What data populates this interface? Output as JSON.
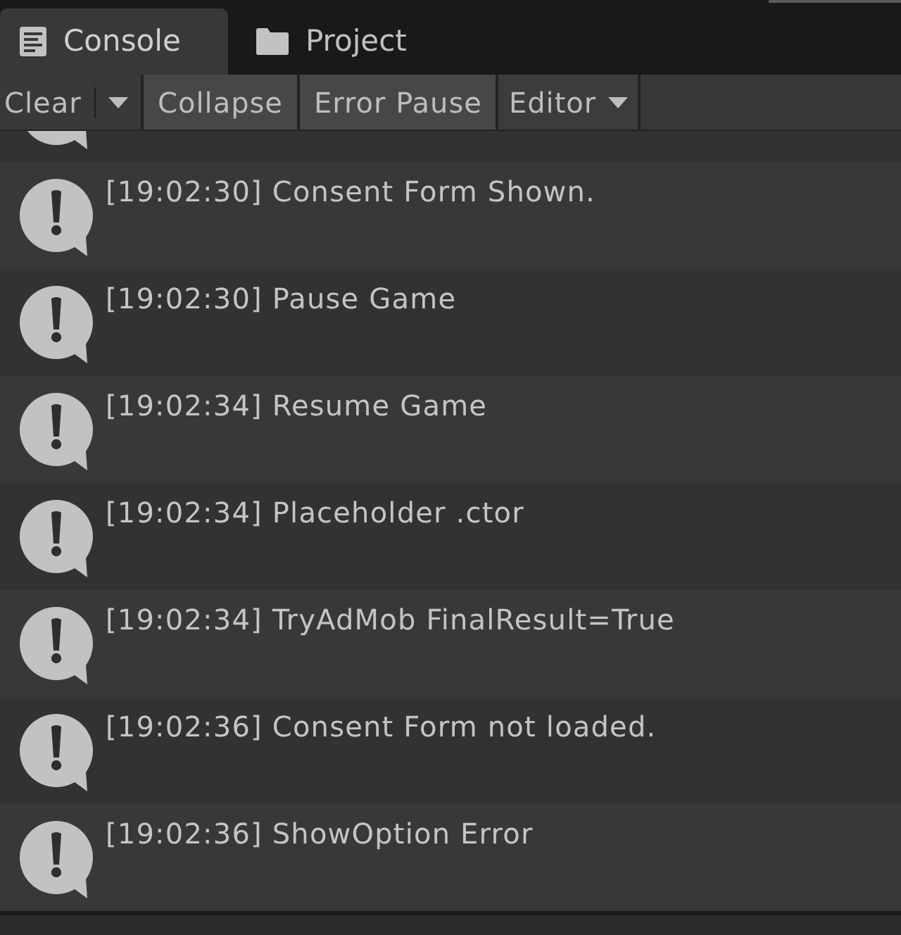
{
  "tabs": [
    {
      "label": "Console",
      "kind": "console",
      "selected": true
    },
    {
      "label": "Project",
      "kind": "folder",
      "selected": false
    }
  ],
  "toolbar": [
    {
      "kind": "split",
      "label": "Clear"
    },
    {
      "kind": "toggle",
      "label": "Collapse",
      "on": true
    },
    {
      "kind": "toggle",
      "label": "Error Pause",
      "on": true
    },
    {
      "kind": "dropdown",
      "label": "Editor"
    }
  ],
  "log": {
    "clipped_entry_above": true,
    "entries": [
      {
        "kind": "log",
        "text": "[19:02:30] Consent Form Shown."
      },
      {
        "kind": "log",
        "text": "[19:02:30] Pause Game"
      },
      {
        "kind": "log",
        "text": "[19:02:34] Resume Game"
      },
      {
        "kind": "log",
        "text": "[19:02:34] Placeholder .ctor"
      },
      {
        "kind": "log",
        "text": "[19:02:34] TryAdMob FinalResult=True"
      },
      {
        "kind": "log",
        "text": "[19:02:36] Consent Form not loaded."
      },
      {
        "kind": "log",
        "text": "[19:02:36] ShowOption Error"
      }
    ]
  }
}
